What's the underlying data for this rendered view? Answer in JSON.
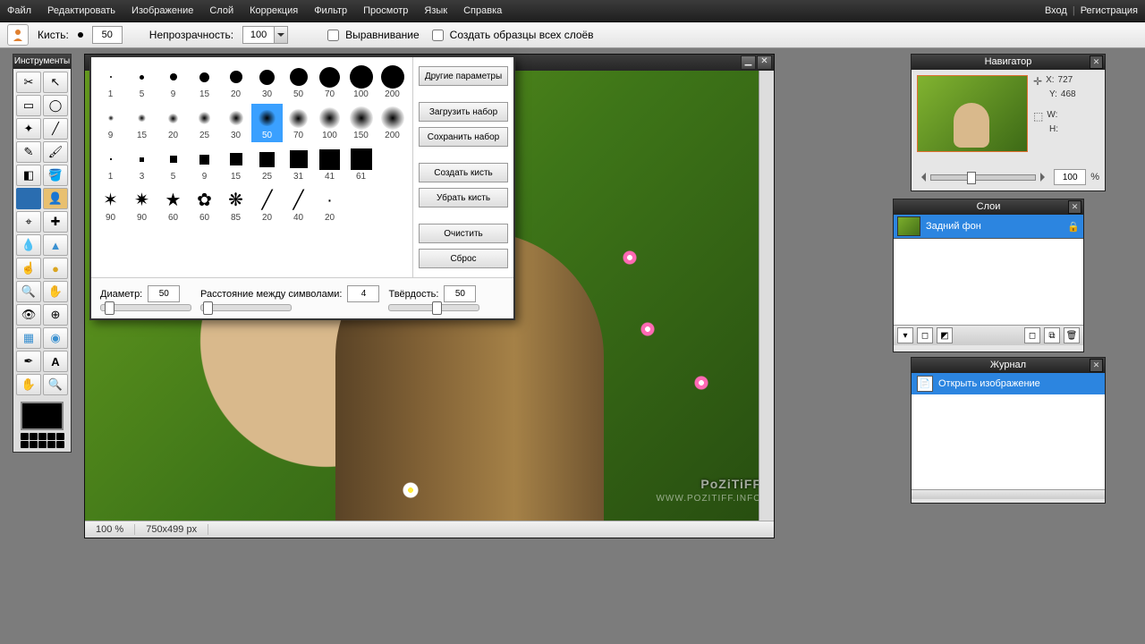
{
  "menu": {
    "items": [
      "Файл",
      "Редактировать",
      "Изображение",
      "Слой",
      "Коррекция",
      "Фильтр",
      "Просмотр",
      "Язык",
      "Справка"
    ],
    "login": "Вход",
    "register": "Регистрация"
  },
  "optbar": {
    "brush_label": "Кисть:",
    "brush_size": "50",
    "opacity_label": "Непрозрачность:",
    "opacity": "100",
    "align": "Выравнивание",
    "sample_all": "Создать образцы всех слоёв"
  },
  "toolbox": {
    "title": "Инструменты",
    "tools": [
      "crop",
      "arrow",
      "rect-sel",
      "lasso",
      "wand",
      "line",
      "pencil",
      "brush",
      "eraser",
      "bucket",
      "grad-rect",
      "grad-user",
      "clone",
      "heal",
      "drop",
      "cone",
      "finger",
      "sponge",
      "zoom-in",
      "hand2",
      "eye",
      "red-fix",
      "blur-rect",
      "blur-circ",
      "pipette",
      "text",
      "hand",
      "zoom"
    ]
  },
  "brushpop": {
    "row1": [
      1,
      5,
      9,
      15,
      20,
      30,
      50,
      70,
      100,
      200
    ],
    "row2": [
      9,
      15,
      20,
      25,
      30,
      50,
      70,
      100,
      150,
      200
    ],
    "row3": [
      1,
      3,
      5,
      9,
      15,
      25,
      31,
      41,
      61
    ],
    "row4": [
      90,
      90,
      60,
      60,
      85,
      20,
      40,
      20
    ],
    "selected": "50",
    "side": {
      "other": "Другие параметры",
      "load": "Загрузить набор",
      "save": "Сохранить набор",
      "create": "Создать кисть",
      "remove": "Убрать кисть",
      "clear": "Очистить",
      "reset": "Сброс"
    },
    "bottom": {
      "diameter_label": "Диаметр:",
      "diameter": "50",
      "spacing_label": "Расстояние между символами:",
      "spacing": "4",
      "hardness_label": "Твёрдость:",
      "hardness": "50"
    }
  },
  "canvas": {
    "zoom": "100 %",
    "dims": "750x499 px",
    "wm1": "PoZiTiFF",
    "wm2": "WWW.POZITIFF.INFO"
  },
  "nav": {
    "title": "Навигатор",
    "x_label": "X:",
    "x": "727",
    "y_label": "Y:",
    "y": "468",
    "w_label": "W:",
    "h_label": "H:",
    "zoom": "100",
    "pct": "%"
  },
  "layers": {
    "title": "Слои",
    "bg": "Задний фон"
  },
  "history": {
    "title": "Журнал",
    "open": "Открыть изображение"
  }
}
